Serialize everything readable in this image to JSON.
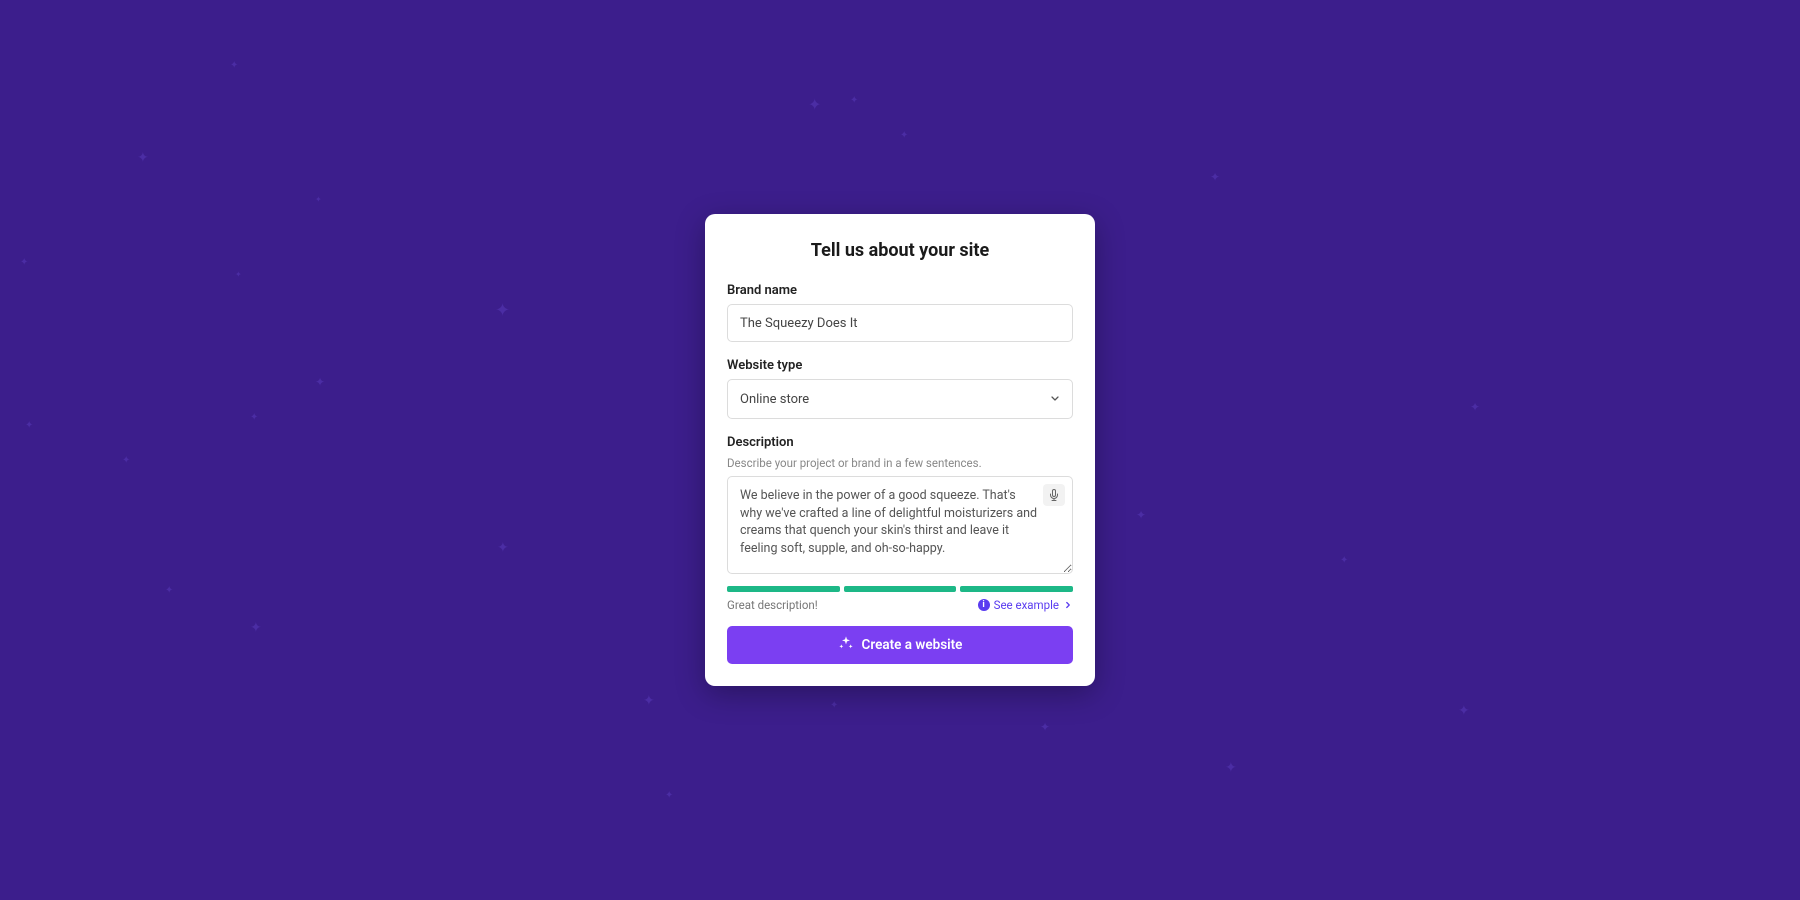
{
  "card": {
    "title": "Tell us about your site",
    "brand_name": {
      "label": "Brand name",
      "value": "The Squeezy Does It"
    },
    "website_type": {
      "label": "Website type",
      "value": "Online store"
    },
    "description": {
      "label": "Description",
      "helper": "Describe your project or brand in a few sentences.",
      "value": "We believe in the power of a good squeeze. That's why we've crafted a line of delightful moisturizers and creams that quench your skin's thirst and leave it feeling soft, supple, and oh-so-happy."
    },
    "feedback": {
      "text": "Great description!",
      "see_example": "See example"
    },
    "submit_label": "Create a website"
  },
  "colors": {
    "background": "#3c1e8c",
    "accent": "#7b3ff2",
    "success": "#1db887"
  }
}
